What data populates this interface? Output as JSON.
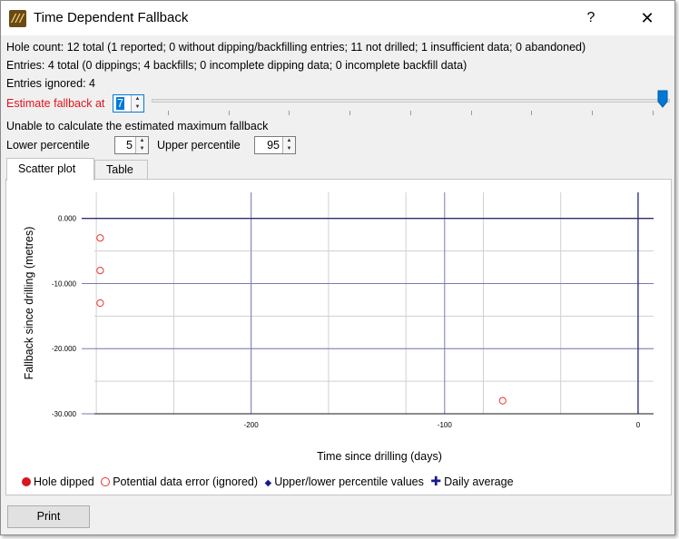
{
  "window": {
    "title": "Time Dependent Fallback",
    "help_label": "?",
    "close_label": "✕",
    "app_icon_glyph": "///"
  },
  "info": {
    "hole_count": "Hole count: 12 total (1 reported; 0 without dipping/backfilling entries; 11 not drilled; 1 insufficient data; 0 abandoned)",
    "entries": "Entries: 4 total (0 dippings; 4 backfills; 0 incomplete dipping data; 0 incomplete backfill data)",
    "entries_ignored": "Entries ignored: 4"
  },
  "estimate": {
    "label": "Estimate fallback at",
    "value": "7",
    "slider_fraction": 1.0
  },
  "status_message": "Unable to calculate the estimated maximum fallback",
  "percentiles": {
    "lower_label": "Lower percentile",
    "lower_value": "5",
    "upper_label": "Upper percentile",
    "upper_value": "95"
  },
  "tabs": [
    {
      "label": "Scatter plot",
      "active": true
    },
    {
      "label": "Table",
      "active": false
    }
  ],
  "chart_data": {
    "type": "scatter",
    "xlabel": "Time since drilling (days)",
    "ylabel": "Fallback since drilling (metres)",
    "xlim": [
      -281,
      8
    ],
    "ylim": [
      -30,
      4
    ],
    "x_ticks": [
      -200,
      -100,
      0
    ],
    "x_tick_labels": [
      "-200",
      "-100",
      "0"
    ],
    "y_ticks": [
      0,
      -10,
      -20,
      -30
    ],
    "y_tick_labels": [
      "0.000",
      "-10.000",
      "-20.000",
      "-30.000"
    ],
    "grid": true,
    "series": [
      {
        "name": "Potential data error (ignored)",
        "marker": "open-circle",
        "color": "#e8332a",
        "points": [
          {
            "x": -278,
            "y": -3
          },
          {
            "x": -278,
            "y": -8
          },
          {
            "x": -278,
            "y": -13
          },
          {
            "x": -70,
            "y": -28
          }
        ]
      }
    ]
  },
  "legend": [
    {
      "label": "Hole dipped",
      "icon": "filled-circle",
      "color": "#d8161f"
    },
    {
      "label": "Potential data error (ignored)",
      "icon": "open-circle",
      "color": "#e8332a"
    },
    {
      "label": "Upper/lower percentile values",
      "icon": "diamond",
      "color": "#1a1a8c"
    },
    {
      "label": "Daily average",
      "icon": "plus",
      "color": "#1a1a8c"
    }
  ],
  "print_label": "Print"
}
